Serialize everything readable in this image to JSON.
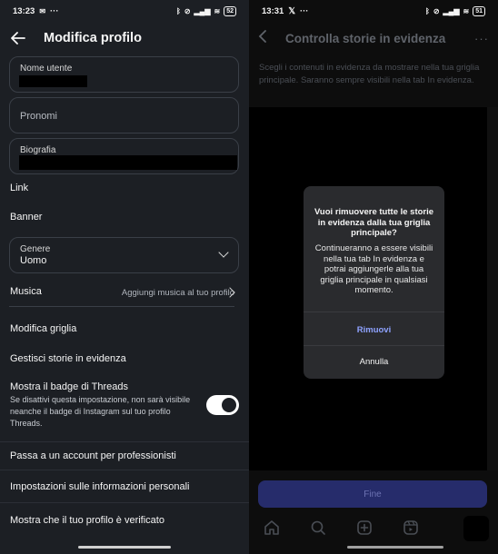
{
  "left": {
    "status": {
      "time": "13:23",
      "battery": "52"
    },
    "header": {
      "title": "Modifica profilo"
    },
    "fields": {
      "username_label": "Nome utente",
      "pronouns_placeholder": "Pronomi",
      "bio_label": "Biografia",
      "gender_label": "Genere",
      "gender_value": "Uomo"
    },
    "rows": {
      "link": "Link",
      "banner": "Banner",
      "music": "Musica",
      "music_action": "Aggiungi musica al tuo profilo",
      "edit_grid": "Modifica griglia",
      "manage_highlights": "Gestisci storie in evidenza",
      "threads_badge": "Mostra il badge di Threads",
      "threads_badge_desc": "Se disattivi questa impostazione, non sarà visibile neanche il badge di Instagram sul tuo profilo Threads.",
      "professional": "Passa a un account per professionisti",
      "personal_info": "Impostazioni sulle informazioni personali",
      "verified": "Mostra che il tuo profilo è verificato"
    }
  },
  "right": {
    "status": {
      "time": "13:31",
      "battery": "51"
    },
    "header": {
      "title": "Controlla storie in evidenza"
    },
    "description": "Scegli i contenuti in evidenza da mostrare nella tua griglia principale. Saranno sempre visibili nella tab In evidenza.",
    "dialog": {
      "title": "Vuoi rimuovere tutte le storie in evidenza dalla tua griglia principale?",
      "body": "Continueranno a essere visibili nella tua tab In evidenza e potrai aggiungerle alla tua griglia principale in qualsiasi momento.",
      "remove": "Rimuovi",
      "cancel": "Annulla"
    },
    "done_button": "Fine",
    "nav_icons": [
      "home-icon",
      "search-icon",
      "create-icon",
      "reels-icon",
      "profile-icon"
    ]
  },
  "colors": {
    "left_bg": "#1c1f24",
    "accent_link": "#8ea2ff",
    "done_button_bg": "#262c6b"
  }
}
